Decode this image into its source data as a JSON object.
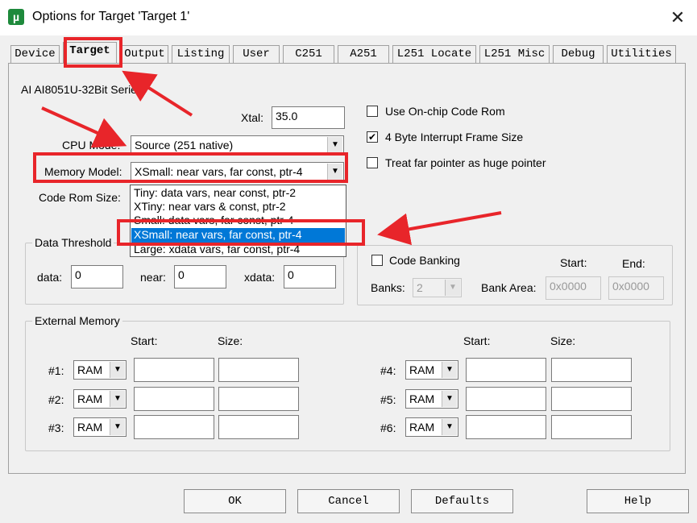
{
  "window": {
    "title": "Options for Target 'Target 1'",
    "app_icon": "µ",
    "close_glyph": "✕"
  },
  "tabs": [
    {
      "label": "Device"
    },
    {
      "label": "Target"
    },
    {
      "label": "Output"
    },
    {
      "label": "Listing"
    },
    {
      "label": "User"
    },
    {
      "label": "C251"
    },
    {
      "label": "A251"
    },
    {
      "label": "L251 Locate"
    },
    {
      "label": "L251 Misc"
    },
    {
      "label": "Debug"
    },
    {
      "label": "Utilities"
    }
  ],
  "device_name": "AI AI8051U-32Bit Series",
  "xtal": {
    "label": "Xtal:",
    "value": "35.0"
  },
  "cpu_mode": {
    "label": "CPU Mode:",
    "value": "Source (251 native)"
  },
  "memory_model": {
    "label": "Memory Model:",
    "value": "XSmall: near vars, far const, ptr-4",
    "options": [
      "Tiny: data vars, near const, ptr-2",
      "XTiny: near vars & const, ptr-2",
      "Small: data vars, far const, ptr-4",
      "XSmall: near vars, far const, ptr-4",
      "Large: xdata vars, far const, ptr-4"
    ],
    "selected_index": 3
  },
  "code_rom_size": {
    "label": "Code Rom Size:"
  },
  "options_checks": [
    {
      "label": "Use On-chip Code Rom",
      "checked": false
    },
    {
      "label": "4 Byte Interrupt Frame Size",
      "checked": true
    },
    {
      "label": "Treat far pointer as huge pointer",
      "checked": false
    }
  ],
  "data_threshold": {
    "title": "Data Threshold",
    "data_label": "data:",
    "data_value": "0",
    "near_label": "near:",
    "near_value": "0",
    "xdata_label": "xdata:",
    "xdata_value": "0"
  },
  "code_banking": {
    "label": "Code Banking",
    "checked": false,
    "banks_label": "Banks:",
    "banks_value": "2",
    "bank_area_label": "Bank Area:",
    "start_label": "Start:",
    "end_label": "End:",
    "start_value": "0x0000",
    "end_value": "0x0000"
  },
  "external_memory": {
    "title": "External Memory",
    "start_label": "Start:",
    "size_label": "Size:",
    "rows": [
      {
        "label": "#1:",
        "type": "RAM"
      },
      {
        "label": "#2:",
        "type": "RAM"
      },
      {
        "label": "#3:",
        "type": "RAM"
      },
      {
        "label": "#4:",
        "type": "RAM"
      },
      {
        "label": "#5:",
        "type": "RAM"
      },
      {
        "label": "#6:",
        "type": "RAM"
      }
    ]
  },
  "buttons": {
    "ok": "OK",
    "cancel": "Cancel",
    "defaults": "Defaults",
    "help": "Help"
  },
  "colors": {
    "annotation_red": "#e8252a",
    "selection_blue": "#0078d7"
  }
}
